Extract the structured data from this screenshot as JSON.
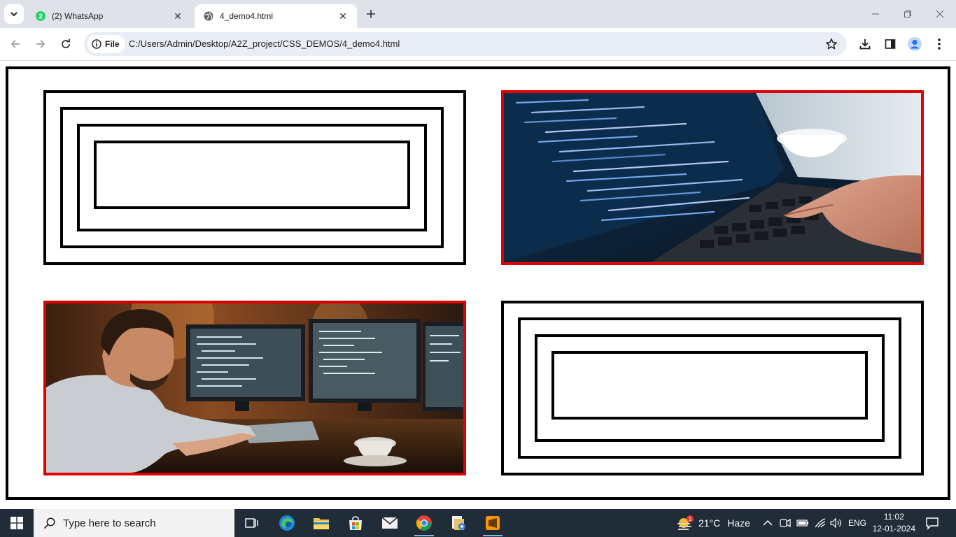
{
  "browser": {
    "tabs": [
      {
        "title": "(2) WhatsApp",
        "badge": "2",
        "active": false,
        "favicon": "whatsapp-icon"
      },
      {
        "title": "4_demo4.html",
        "active": true,
        "favicon": "globe-icon"
      }
    ],
    "address_bar": {
      "scheme_chip": "File",
      "url": "C:/Users/Admin/Desktop/A2Z_project/CSS_DEMOS/4_demo4.html"
    }
  },
  "page": {
    "layout": "2x2 grid inside black bordered container",
    "cells": [
      {
        "type": "nested-boxes",
        "nested_levels": 4,
        "border_color": "#000000"
      },
      {
        "type": "image",
        "subject": "laptop with code on screen",
        "border_color": "#e00000"
      },
      {
        "type": "image",
        "subject": "developer working at multiple monitors",
        "border_color": "#e00000"
      },
      {
        "type": "nested-boxes",
        "nested_levels": 4,
        "border_color": "#000000"
      }
    ]
  },
  "taskbar": {
    "search_placeholder": "Type here to search",
    "weather": {
      "temperature": "21°C",
      "condition": "Haze",
      "alert_badge": "1"
    },
    "language": "ENG",
    "time": "11:02",
    "date": "12-01-2024",
    "pinned_apps": [
      "task-view-icon",
      "edge-icon",
      "file-explorer-icon",
      "store-icon",
      "mail-icon",
      "chrome-icon",
      "file-manager-icon",
      "sublime-text-icon"
    ]
  },
  "colors": {
    "accent_red": "#e00000",
    "taskbar_bg": "#202c38",
    "tabstrip_bg": "#dfe3e9"
  }
}
